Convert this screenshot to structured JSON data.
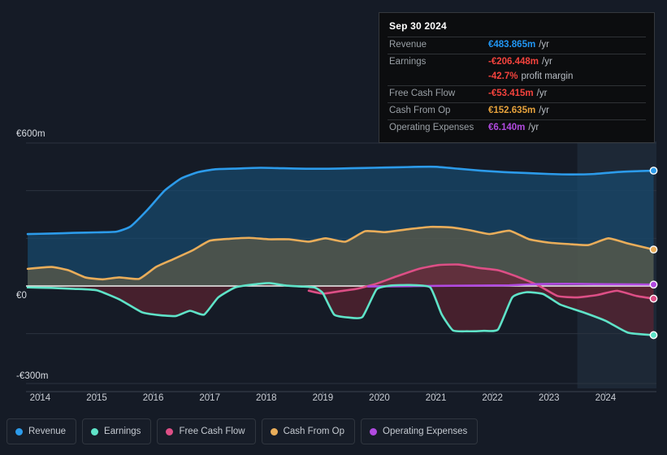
{
  "tooltip": {
    "date": "Sep 30 2024",
    "rows": [
      {
        "key": "Revenue",
        "value": "€483.865m",
        "unit": "/yr",
        "color": "#2196f3"
      },
      {
        "key": "Earnings",
        "value": "-€206.448m",
        "unit": "/yr",
        "color": "#f4433d"
      },
      {
        "key": "",
        "value": "-42.7%",
        "unit": "profit margin",
        "color": "#f4433d"
      },
      {
        "key": "Free Cash Flow",
        "value": "-€53.415m",
        "unit": "/yr",
        "color": "#f4433d"
      },
      {
        "key": "Cash From Op",
        "value": "€152.635m",
        "unit": "/yr",
        "color": "#e6a23c"
      },
      {
        "key": "Operating Expenses",
        "value": "€6.140m",
        "unit": "/yr",
        "color": "#b14ae0"
      }
    ]
  },
  "legend": [
    {
      "label": "Revenue",
      "color": "#2c9bea"
    },
    {
      "label": "Earnings",
      "color": "#5fe3c8"
    },
    {
      "label": "Free Cash Flow",
      "color": "#dd4f86"
    },
    {
      "label": "Cash From Op",
      "color": "#e9ad5a"
    },
    {
      "label": "Operating Expenses",
      "color": "#b14ae0"
    }
  ],
  "axis": {
    "y_top": "€600m",
    "y_zero": "€0",
    "y_bottom": "-€300m"
  },
  "chart_data": {
    "type": "area",
    "title": "",
    "xlabel": "",
    "ylabel": "",
    "currency": "EUR",
    "units": "millions per year",
    "grid": true,
    "legend_position": "bottom",
    "xlim": [
      2013.75,
      2024.9
    ],
    "ylim": [
      -300,
      600
    ],
    "yticks": [
      600,
      400,
      200,
      0,
      -200
    ],
    "ytick_labels": [
      "€600m",
      "",
      "",
      "€0",
      ""
    ],
    "categories": [
      2014,
      2015,
      2016,
      2017,
      2018,
      2019,
      2020,
      2021,
      2022,
      2023,
      2024
    ],
    "tick_labels": [
      "2014",
      "2015",
      "2016",
      "2017",
      "2018",
      "2019",
      "2020",
      "2021",
      "2022",
      "2023",
      "2024"
    ],
    "highlight_band": {
      "from": 2023.5,
      "to": 2024.9
    },
    "series": [
      {
        "name": "Revenue",
        "color": "#2c9bea",
        "fill": "#17496e",
        "x": [
          2013.78,
          2014.2,
          2014.6,
          2015.0,
          2015.35,
          2015.6,
          2015.9,
          2016.2,
          2016.5,
          2016.8,
          2017.1,
          2017.5,
          2017.9,
          2018.3,
          2018.7,
          2019.1,
          2019.5,
          2019.9,
          2020.3,
          2020.7,
          2021.0,
          2021.4,
          2021.8,
          2022.2,
          2022.6,
          2023.0,
          2023.4,
          2023.8,
          2024.2,
          2024.6,
          2024.85
        ],
        "values": [
          218,
          220,
          223,
          225,
          228,
          250,
          320,
          400,
          452,
          478,
          490,
          493,
          496,
          494,
          492,
          492,
          494,
          496,
          498,
          500,
          500,
          492,
          484,
          478,
          474,
          470,
          468,
          470,
          478,
          482,
          484
        ]
      },
      {
        "name": "Cash From Op",
        "color": "#e9ad5a",
        "fill": "#5e5b46",
        "x": [
          2013.78,
          2014.2,
          2014.5,
          2014.8,
          2015.1,
          2015.4,
          2015.75,
          2016.05,
          2016.35,
          2016.7,
          2017.0,
          2017.35,
          2017.7,
          2018.05,
          2018.4,
          2018.75,
          2019.05,
          2019.4,
          2019.75,
          2020.1,
          2020.5,
          2020.9,
          2021.25,
          2021.6,
          2021.95,
          2022.3,
          2022.65,
          2023.0,
          2023.35,
          2023.7,
          2024.05,
          2024.4,
          2024.85
        ],
        "values": [
          72,
          80,
          66,
          36,
          28,
          36,
          30,
          80,
          112,
          150,
          190,
          198,
          202,
          196,
          196,
          186,
          200,
          186,
          230,
          226,
          238,
          248,
          246,
          234,
          218,
          232,
          196,
          182,
          176,
          172,
          200,
          178,
          153
        ]
      },
      {
        "name": "Free Cash Flow",
        "color": "#dd4f86",
        "fill": "#6b2338",
        "x": [
          2018.75,
          2019.0,
          2019.3,
          2019.6,
          2019.95,
          2020.3,
          2020.7,
          2021.05,
          2021.4,
          2021.75,
          2022.1,
          2022.45,
          2022.8,
          2023.15,
          2023.5,
          2023.85,
          2024.2,
          2024.55,
          2024.85
        ],
        "values": [
          -20,
          -32,
          -22,
          -12,
          10,
          40,
          72,
          88,
          90,
          76,
          66,
          38,
          4,
          -42,
          -48,
          -38,
          -20,
          -42,
          -53
        ]
      },
      {
        "name": "Operating Expenses",
        "color": "#b14ae0",
        "fill": "#3e2152",
        "x": [
          2019.8,
          2020.3,
          2020.8,
          2021.3,
          2021.8,
          2022.3,
          2022.8,
          2023.3,
          2023.8,
          2024.3,
          2024.85
        ],
        "values": [
          -2,
          -1,
          0,
          1,
          2,
          3,
          8,
          9,
          8,
          7,
          6
        ]
      },
      {
        "name": "Earnings",
        "color": "#5fe3c8",
        "fill": "#5a2230",
        "x": [
          2013.78,
          2014.2,
          2014.6,
          2015.0,
          2015.4,
          2015.8,
          2016.1,
          2016.4,
          2016.65,
          2016.9,
          2017.15,
          2017.45,
          2017.75,
          2018.05,
          2018.35,
          2018.6,
          2018.85,
          2019.0,
          2019.2,
          2019.45,
          2019.7,
          2019.95,
          2020.2,
          2020.55,
          2020.9,
          2021.1,
          2021.3,
          2021.55,
          2021.85,
          2022.1,
          2022.35,
          2022.6,
          2022.9,
          2023.2,
          2023.6,
          2024.0,
          2024.4,
          2024.85
        ],
        "values": [
          -6,
          -8,
          -12,
          -18,
          -56,
          -110,
          -122,
          -126,
          -104,
          -120,
          -48,
          -6,
          6,
          12,
          2,
          -2,
          -6,
          -30,
          -120,
          -132,
          -130,
          -14,
          2,
          4,
          -6,
          -118,
          -186,
          -190,
          -188,
          -182,
          -48,
          -26,
          -34,
          -78,
          -110,
          -146,
          -196,
          -206
        ]
      }
    ]
  }
}
